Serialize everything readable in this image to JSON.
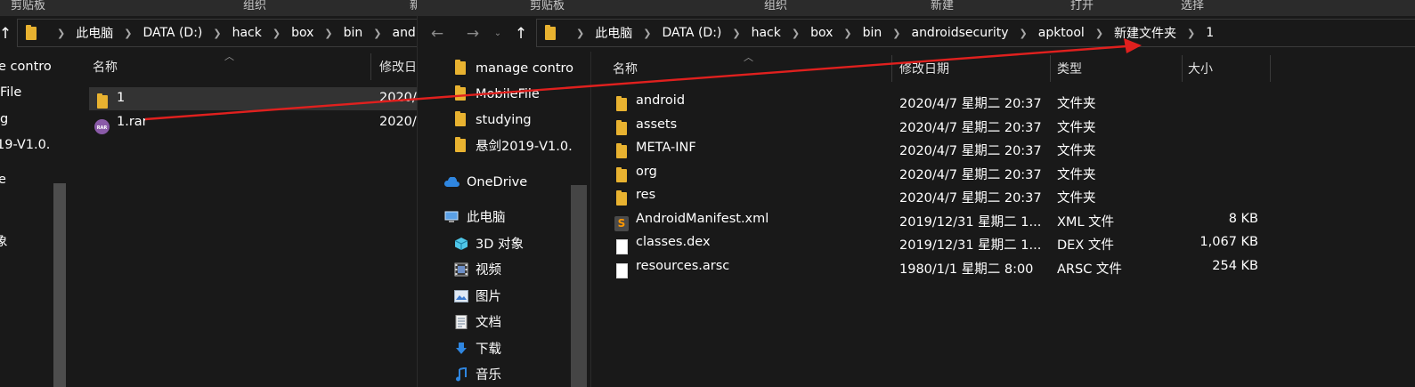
{
  "left_window": {
    "ribbon": [
      "剪贴板",
      "组织",
      "新"
    ],
    "address": [
      "此电脑",
      "DATA (D:)",
      "hack",
      "box",
      "bin",
      "androidse"
    ],
    "sidebar": [
      "e contro",
      "File",
      "g",
      "19-V1.0.",
      "e",
      "象"
    ],
    "columns": {
      "name": "名称",
      "modified": "修改日"
    },
    "files": [
      {
        "name": "1",
        "modified": "2020/",
        "icon": "folder-icon"
      },
      {
        "name": "1.rar",
        "modified": "2020/",
        "icon": "rar-icon"
      }
    ]
  },
  "right_window": {
    "ribbon": [
      "剪贴板",
      "组织",
      "新建",
      "打开",
      "选择"
    ],
    "nav": {
      "back": "←",
      "forward": "→",
      "up": "↑"
    },
    "address": [
      "此电脑",
      "DATA (D:)",
      "hack",
      "box",
      "bin",
      "androidsecurity",
      "apktool",
      "新建文件夹",
      "1"
    ],
    "quick_access": [
      "manage contro",
      "MobileFile",
      "studying",
      "悬剑2019-V1.0."
    ],
    "onedrive": "OneDrive",
    "this_pc": "此电脑",
    "libraries": [
      {
        "label": "3D 对象",
        "icon": "3d-objects-icon"
      },
      {
        "label": "视频",
        "icon": "video-icon"
      },
      {
        "label": "图片",
        "icon": "pictures-icon"
      },
      {
        "label": "文档",
        "icon": "documents-icon"
      },
      {
        "label": "下载",
        "icon": "download-icon"
      },
      {
        "label": "音乐",
        "icon": "music-icon"
      }
    ],
    "columns": {
      "name": "名称",
      "modified": "修改日期",
      "type": "类型",
      "size": "大小"
    },
    "files": [
      {
        "name": "android",
        "modified": "2020/4/7 星期二 20:37",
        "type": "文件夹",
        "size": "",
        "icon": "folder-icon"
      },
      {
        "name": "assets",
        "modified": "2020/4/7 星期二 20:37",
        "type": "文件夹",
        "size": "",
        "icon": "folder-icon"
      },
      {
        "name": "META-INF",
        "modified": "2020/4/7 星期二 20:37",
        "type": "文件夹",
        "size": "",
        "icon": "folder-icon"
      },
      {
        "name": "org",
        "modified": "2020/4/7 星期二 20:37",
        "type": "文件夹",
        "size": "",
        "icon": "folder-icon"
      },
      {
        "name": "res",
        "modified": "2020/4/7 星期二 20:37",
        "type": "文件夹",
        "size": "",
        "icon": "folder-icon"
      },
      {
        "name": "AndroidManifest.xml",
        "modified": "2019/12/31 星期二 1...",
        "type": "XML 文件",
        "size": "8 KB",
        "icon": "sublime-text-icon"
      },
      {
        "name": "classes.dex",
        "modified": "2019/12/31 星期二 1...",
        "type": "DEX 文件",
        "size": "1,067 KB",
        "icon": "file-icon"
      },
      {
        "name": "resources.arsc",
        "modified": "1980/1/1 星期二 8:00",
        "type": "ARSC 文件",
        "size": "254 KB",
        "icon": "file-icon"
      }
    ]
  },
  "annotation": {
    "color": "#e0201e"
  }
}
